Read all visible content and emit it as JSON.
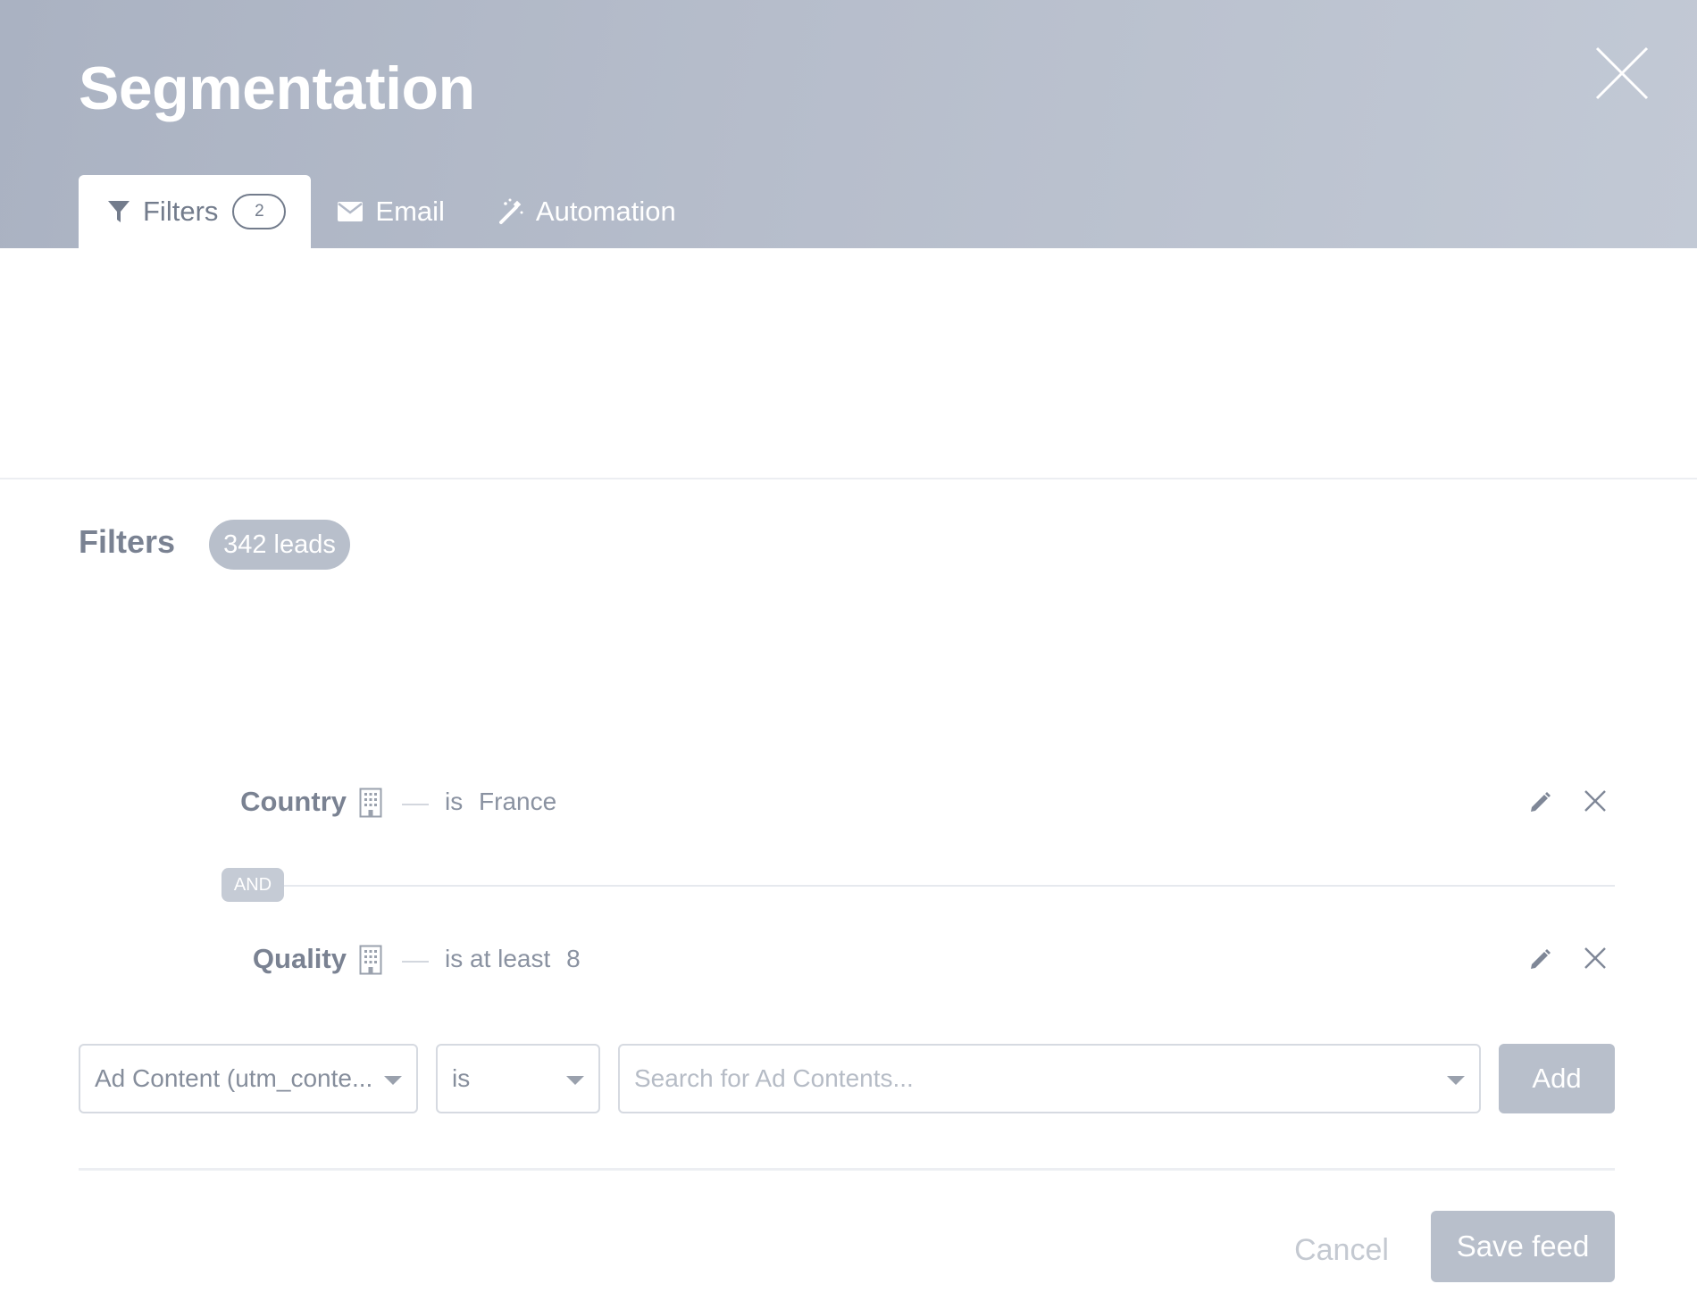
{
  "header": {
    "title": "Segmentation",
    "tabs": [
      {
        "label": "Filters",
        "count": "2",
        "icon": "filter-icon",
        "active": true
      },
      {
        "label": "Email",
        "icon": "envelope-icon",
        "active": false
      },
      {
        "label": "Automation",
        "icon": "magic-wand-icon",
        "active": false
      }
    ]
  },
  "filters": {
    "title": "Filters",
    "leads_count": "342 leads",
    "conjunction": "AND",
    "rows": [
      {
        "field": "Country",
        "operator": "is",
        "value": "France"
      },
      {
        "field": "Quality",
        "operator": "is at least",
        "value": "8"
      }
    ]
  },
  "new_filter": {
    "field": "Ad Content (utm_conte...",
    "operator": "is",
    "value_placeholder": "Search for Ad Contents...",
    "add_label": "Add"
  },
  "footer": {
    "cancel_label": "Cancel",
    "save_label": "Save feed"
  },
  "colors": {
    "header_bg": "#b6bdcb",
    "button_bg": "#b8bfcb",
    "text": "#7a8292"
  }
}
